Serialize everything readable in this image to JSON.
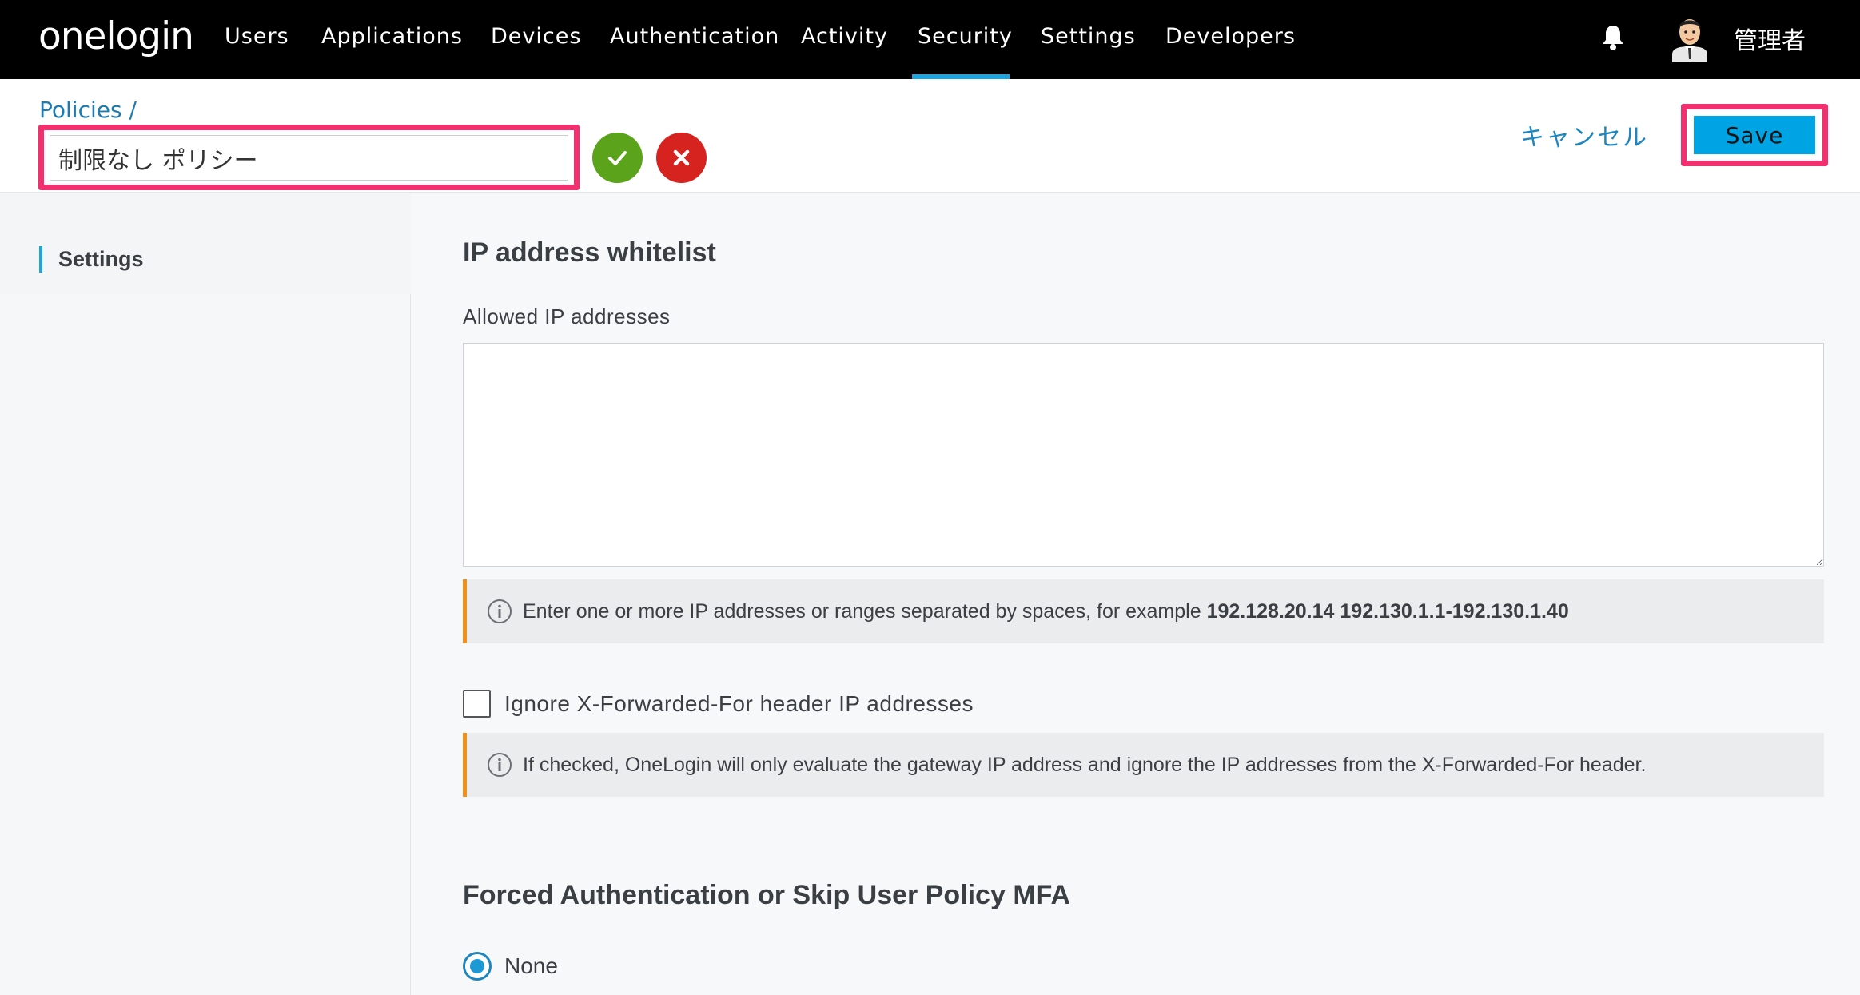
{
  "brand": {
    "logo": "onelogin",
    "accent": "#1fa5dd",
    "highlight": "#f3306f"
  },
  "nav": {
    "items": [
      {
        "label": "Users"
      },
      {
        "label": "Applications"
      },
      {
        "label": "Devices"
      },
      {
        "label": "Authentication"
      },
      {
        "label": "Activity"
      },
      {
        "label": "Security",
        "active": true
      },
      {
        "label": "Settings"
      },
      {
        "label": "Developers"
      }
    ],
    "user_name": "管理者"
  },
  "header": {
    "breadcrumb": "Policies /",
    "policy_name": "制限なし ポリシー",
    "cancel_label": "キャンセル",
    "save_label": "Save"
  },
  "sidebar": {
    "items": [
      {
        "label": "Settings",
        "active": true
      }
    ]
  },
  "main": {
    "ip_section": {
      "title": "IP address whitelist",
      "field_label": "Allowed IP addresses",
      "value": "",
      "hint_prefix": "Enter one or more IP addresses or ranges separated by spaces, for example ",
      "hint_example": "192.128.20.14 192.130.1.1-192.130.1.40"
    },
    "xff": {
      "label": "Ignore X-Forwarded-For header IP addresses",
      "checked": false,
      "hint": "If checked, OneLogin will only evaluate the gateway IP address and ignore the IP addresses from the X-Forwarded-For header."
    },
    "forced_auth": {
      "title": "Forced Authentication or Skip User Policy MFA",
      "selected_option": "None"
    }
  }
}
